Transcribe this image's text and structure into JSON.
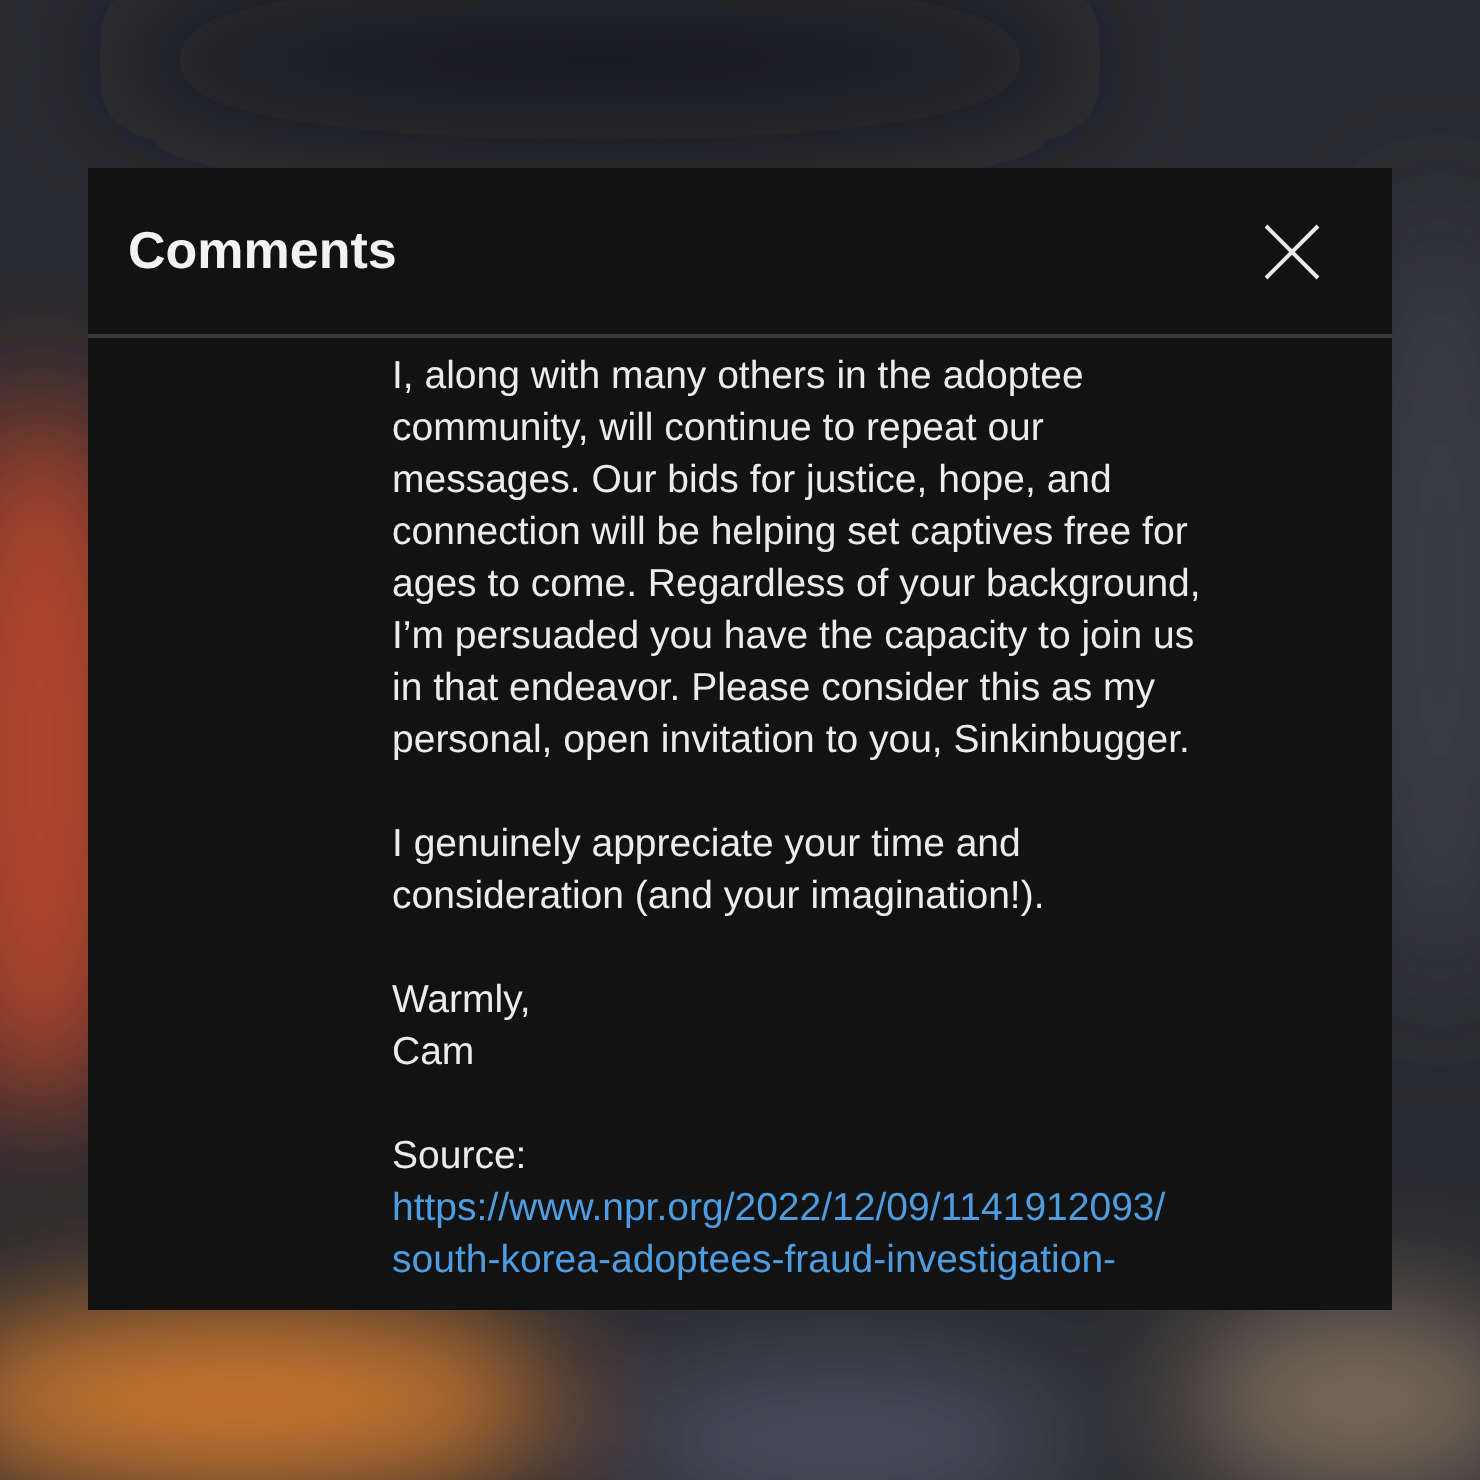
{
  "dialog": {
    "title": "Comments",
    "paragraphs": [
      {
        "lines": [
          "I, along with many others in the adoptee",
          "community, will continue to repeat our",
          "messages. Our bids for justice, hope, and",
          "connection will be helping set captives free for",
          "ages to come. Regardless of your background,",
          "I’m persuaded you have the capacity to join us",
          "in that endeavor. Please consider this as my",
          "personal, open invitation to you, Sinkinbugger."
        ]
      },
      {
        "lines": [
          "I genuinely appreciate your time and",
          "consideration (and your imagination!)."
        ]
      },
      {
        "lines": [
          "Warmly,",
          "Cam"
        ]
      },
      {
        "lines": [
          "Source:"
        ],
        "link": [
          "https://www.npr.org/2022/12/09/1141912093/",
          "south-korea-adoptees-fraud-investigation-"
        ]
      }
    ]
  }
}
